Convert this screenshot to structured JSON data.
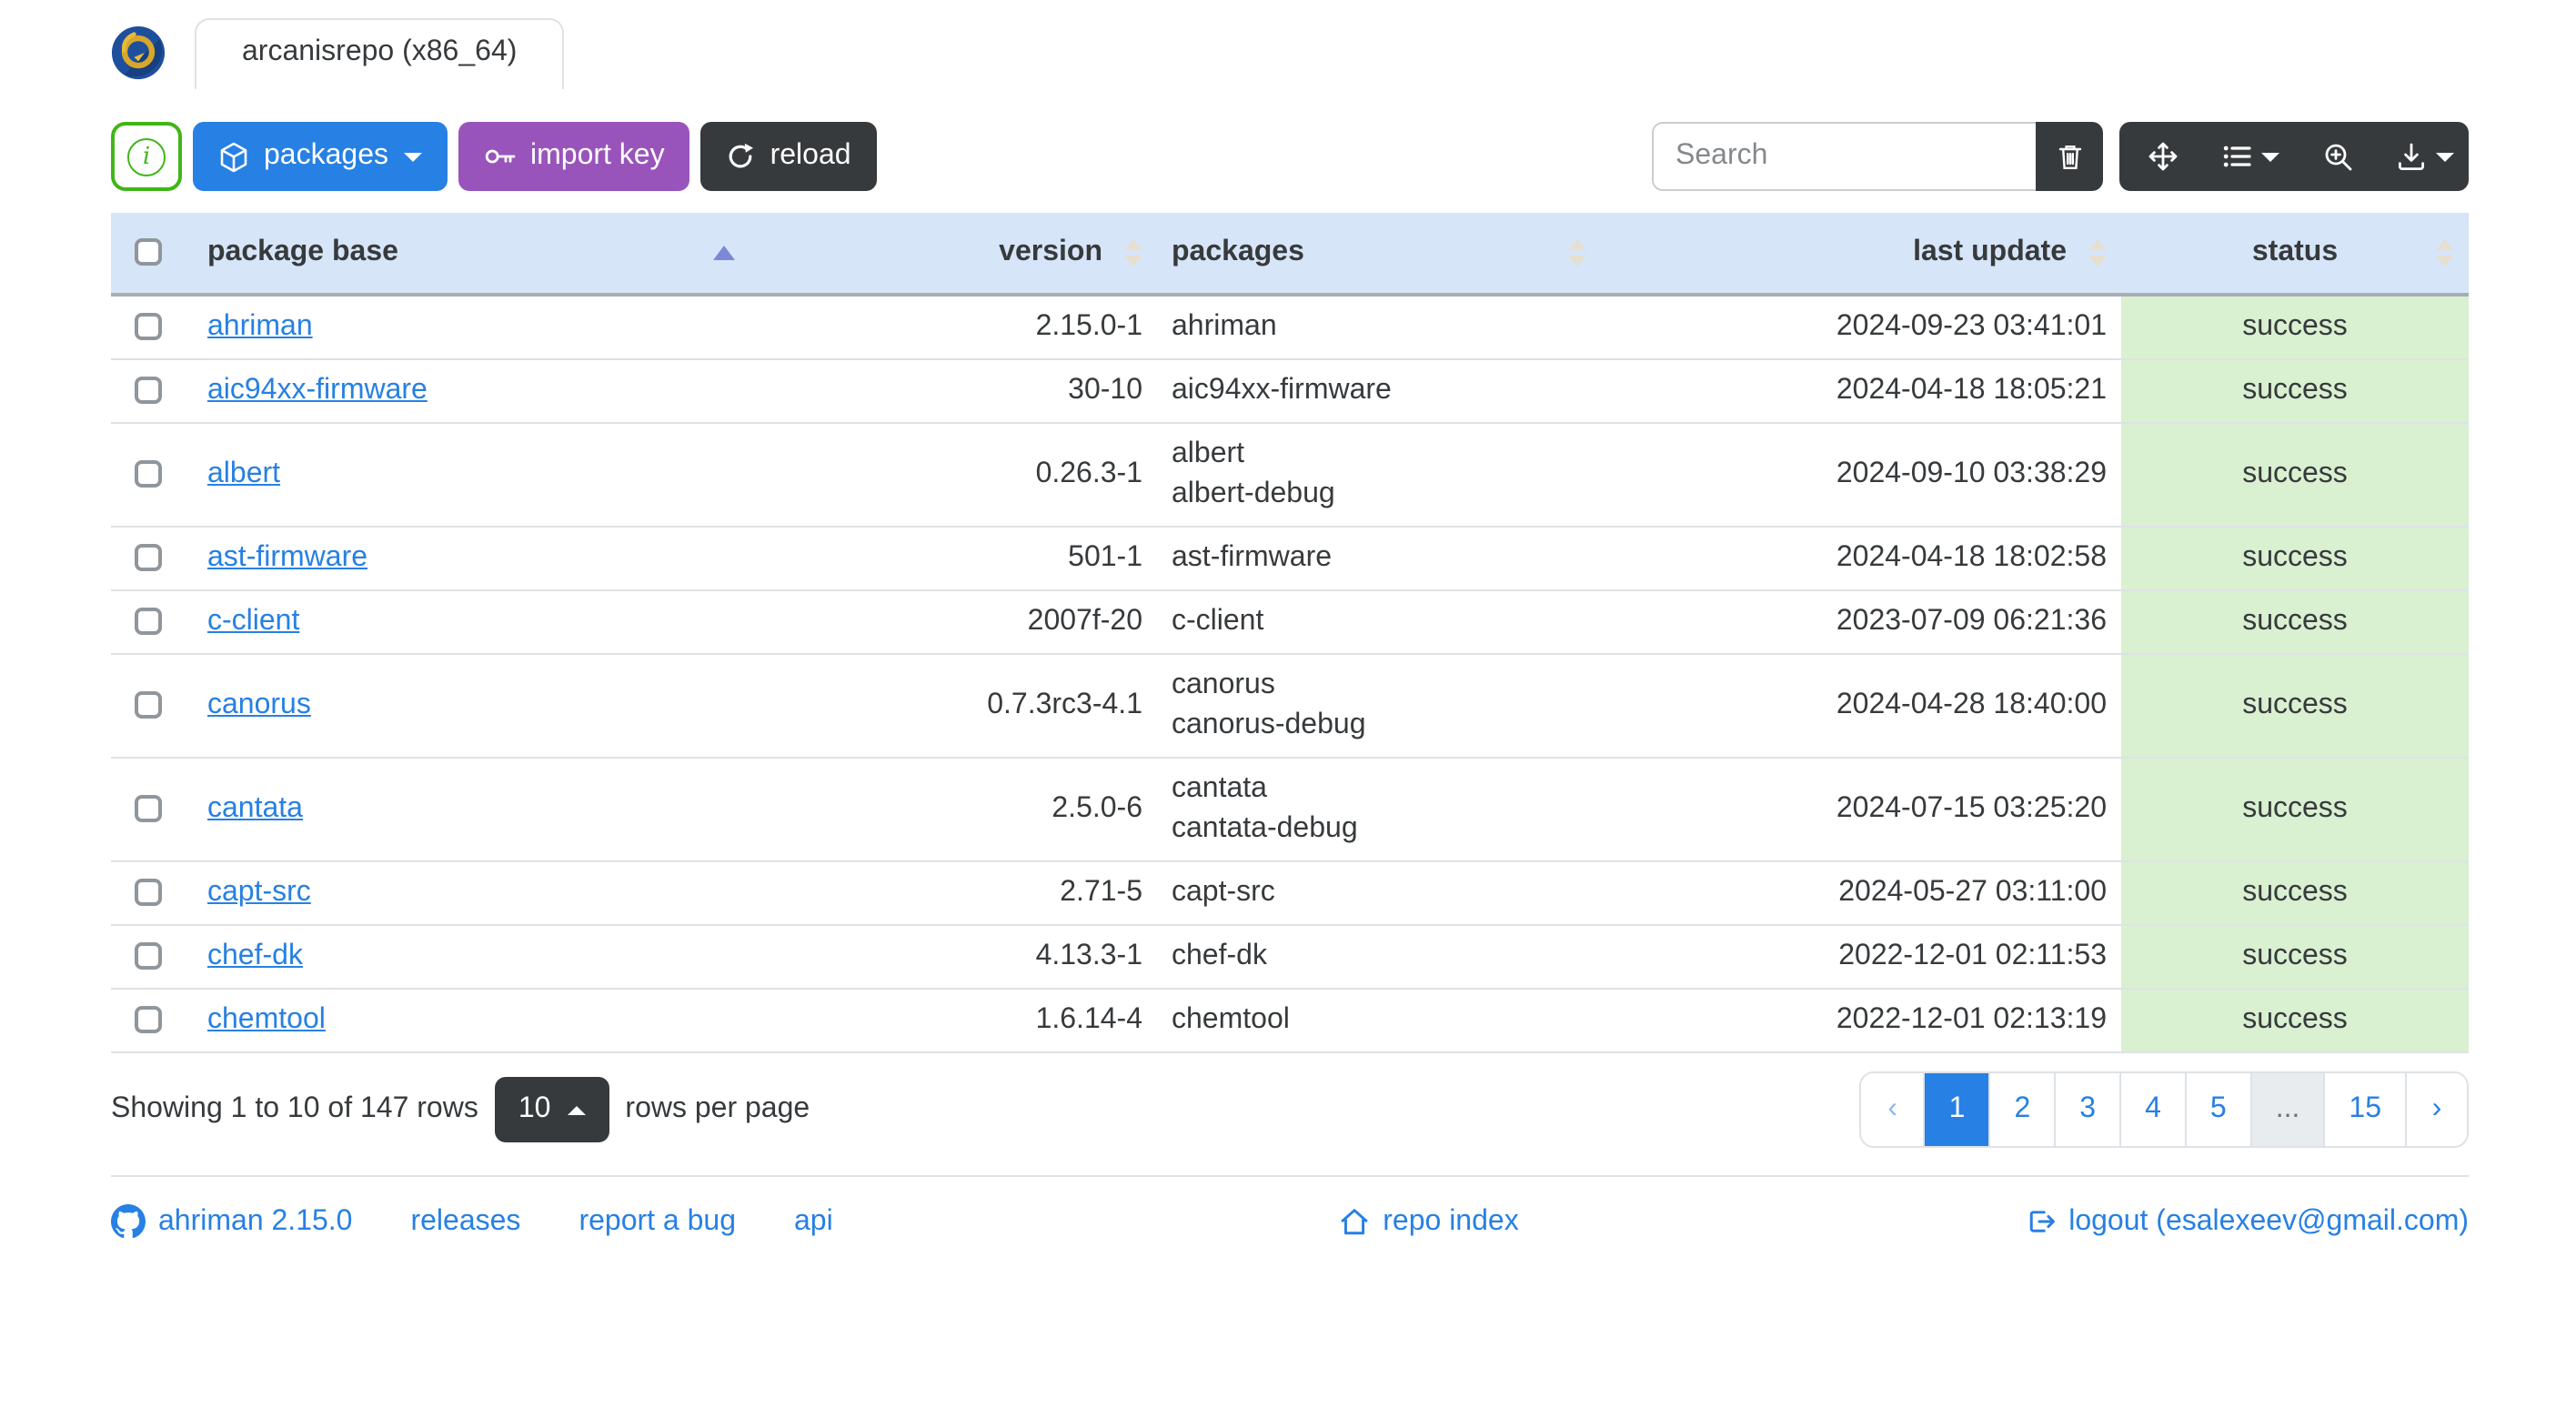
{
  "header": {
    "tab_title": "arcanisrepo (x86_64)"
  },
  "toolbar": {
    "info_button": {
      "icon": "info-circle-icon",
      "glyph": "i"
    },
    "packages_button": {
      "label": "packages",
      "icon": "box-icon"
    },
    "import_key_button": {
      "label": "import key",
      "icon": "key-icon"
    },
    "reload_button": {
      "label": "reload",
      "icon": "arrow-clockwise-icon"
    },
    "search": {
      "placeholder": "Search"
    },
    "clear_button": {
      "icon": "trash-icon"
    },
    "fullscreen_button": {
      "icon": "arrows-move-icon"
    },
    "columns_button": {
      "icon": "list-icon"
    },
    "zoom_button": {
      "icon": "zoom-in-icon"
    },
    "export_button": {
      "icon": "download-icon"
    }
  },
  "table": {
    "columns": [
      "package base",
      "version",
      "packages",
      "last update",
      "status"
    ],
    "sort": {
      "column": "package base",
      "direction": "asc"
    },
    "rows": [
      {
        "base": "ahriman",
        "version": "2.15.0-1",
        "packages": [
          "ahriman"
        ],
        "last_update": "2024-09-23 03:41:01",
        "status": "success"
      },
      {
        "base": "aic94xx-firmware",
        "version": "30-10",
        "packages": [
          "aic94xx-firmware"
        ],
        "last_update": "2024-04-18 18:05:21",
        "status": "success"
      },
      {
        "base": "albert",
        "version": "0.26.3-1",
        "packages": [
          "albert",
          "albert-debug"
        ],
        "last_update": "2024-09-10 03:38:29",
        "status": "success"
      },
      {
        "base": "ast-firmware",
        "version": "501-1",
        "packages": [
          "ast-firmware"
        ],
        "last_update": "2024-04-18 18:02:58",
        "status": "success"
      },
      {
        "base": "c-client",
        "version": "2007f-20",
        "packages": [
          "c-client"
        ],
        "last_update": "2023-07-09 06:21:36",
        "status": "success"
      },
      {
        "base": "canorus",
        "version": "0.7.3rc3-4.1",
        "packages": [
          "canorus",
          "canorus-debug"
        ],
        "last_update": "2024-04-28 18:40:00",
        "status": "success"
      },
      {
        "base": "cantata",
        "version": "2.5.0-6",
        "packages": [
          "cantata",
          "cantata-debug"
        ],
        "last_update": "2024-07-15 03:25:20",
        "status": "success"
      },
      {
        "base": "capt-src",
        "version": "2.71-5",
        "packages": [
          "capt-src"
        ],
        "last_update": "2024-05-27 03:11:00",
        "status": "success"
      },
      {
        "base": "chef-dk",
        "version": "4.13.3-1",
        "packages": [
          "chef-dk"
        ],
        "last_update": "2022-12-01 02:11:53",
        "status": "success"
      },
      {
        "base": "chemtool",
        "version": "1.6.14-4",
        "packages": [
          "chemtool"
        ],
        "last_update": "2022-12-01 02:13:19",
        "status": "success"
      }
    ]
  },
  "footer": {
    "showing_text": "Showing 1 to 10 of 147 rows",
    "page_size": "10",
    "rows_per_page_label": "rows per page"
  },
  "pagination": {
    "prev": "‹",
    "pages": [
      "1",
      "2",
      "3",
      "4",
      "5",
      "...",
      "15"
    ],
    "active": "1",
    "next": "›"
  },
  "links": {
    "version": "ahriman 2.15.0",
    "releases": "releases",
    "report_bug": "report a bug",
    "api": "api",
    "repo_index": "repo index",
    "logout": "logout (esalexeev@gmail.com)"
  },
  "colors": {
    "primary": "#2780e3",
    "info_purple": "#9954bb",
    "success_green": "#3fb618",
    "dark": "#373a3c",
    "table_header_bg": "#d6e5f8",
    "status_success_bg": "#d9f0d1",
    "sort_asc_indicator": "#7d88d8",
    "link": "#2780e3"
  }
}
